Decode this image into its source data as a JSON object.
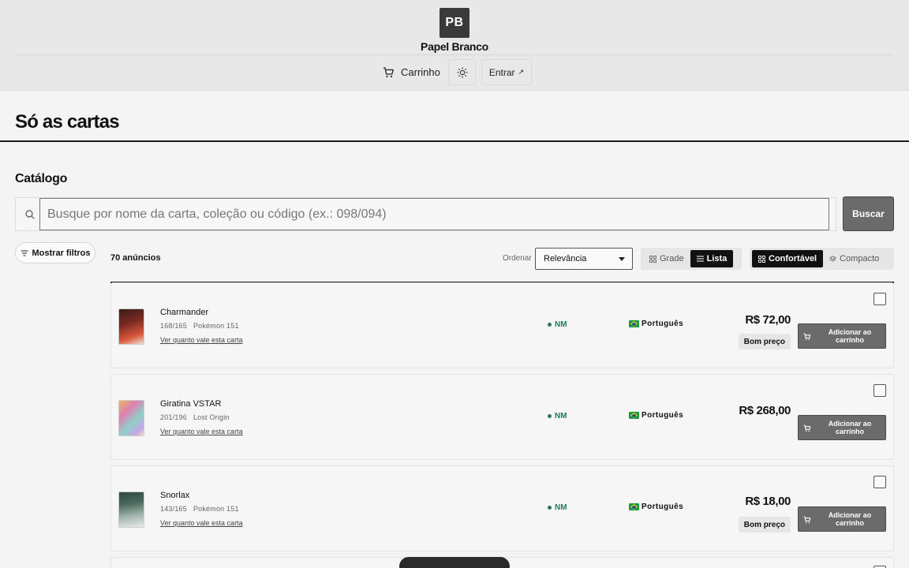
{
  "header": {
    "logo_text": "PB",
    "brand": "Papel Branco",
    "cart_label": "Carrinho",
    "login_label": "Entrar",
    "login_arrow": "↗"
  },
  "page": {
    "title": "Só as cartas",
    "section_title": "Catálogo"
  },
  "search": {
    "placeholder": "Busque por nome da carta, coleção ou código (ex.: 098/094)",
    "button_label": "Buscar"
  },
  "toolbar": {
    "filters_label": "Mostrar filtros",
    "count_label": "70 anúncios",
    "order_label": "Ordenar",
    "order_value": "Relevância",
    "view_options": [
      "Grade",
      "Lista"
    ],
    "view_selected": "Lista",
    "density_options": [
      "Confortável",
      "Compacto"
    ],
    "density_selected": "Confortável"
  },
  "listings": [
    {
      "name": "Charmander",
      "number": "168/165",
      "set": "Pokémon 151",
      "link": "Ver quanto vale esta carta",
      "condition": "NM",
      "language": "Português",
      "price": "R$ 72,00",
      "badge": "Bom preço",
      "add_label": "Adicionar ao carrinho",
      "thumb_colors": [
        "#7a2a22",
        "#d8583a"
      ]
    },
    {
      "name": "Giratina VSTAR",
      "number": "201/196",
      "set": "Lost Origin",
      "link": "Ver quanto vale esta carta",
      "condition": "NM",
      "language": "Português",
      "price": "R$ 268,00",
      "badge": "",
      "add_label": "Adicionar ao carrinho",
      "thumb_colors": [
        "#e9b957",
        "#8fd0c9"
      ]
    },
    {
      "name": "Snorlax",
      "number": "143/165",
      "set": "Pokémon 151",
      "link": "Ver quanto vale esta carta",
      "condition": "NM",
      "language": "Português",
      "price": "R$ 18,00",
      "badge": "Bom preço",
      "add_label": "Adicionar ao carrinho",
      "thumb_colors": [
        "#4d6b5f",
        "#cfd7d4"
      ]
    }
  ]
}
